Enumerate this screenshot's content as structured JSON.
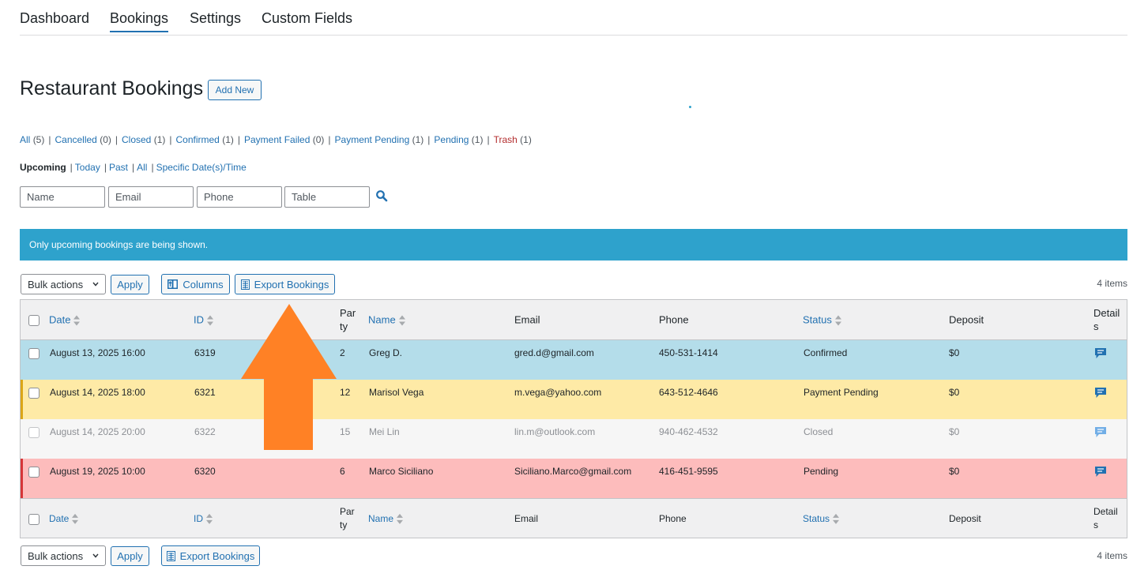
{
  "nav": {
    "tabs": [
      {
        "label": "Dashboard"
      },
      {
        "label": "Bookings"
      },
      {
        "label": "Settings"
      },
      {
        "label": "Custom Fields"
      }
    ]
  },
  "page": {
    "title": "Restaurant Bookings",
    "add_new": "Add New"
  },
  "status_filters": [
    {
      "label": "All",
      "count": "(5)"
    },
    {
      "label": "Cancelled",
      "count": "(0)"
    },
    {
      "label": "Closed",
      "count": "(1)"
    },
    {
      "label": "Confirmed",
      "count": "(1)"
    },
    {
      "label": "Payment Failed",
      "count": "(0)"
    },
    {
      "label": "Payment Pending",
      "count": "(1)"
    },
    {
      "label": "Pending",
      "count": "(1)"
    },
    {
      "label": "Trash",
      "count": "(1)"
    }
  ],
  "time_filters": {
    "current": "Upcoming",
    "items": [
      "Today",
      "Past",
      "All",
      "Specific Date(s)/Time"
    ]
  },
  "search": {
    "name_placeholder": "Name",
    "email_placeholder": "Email",
    "phone_placeholder": "Phone",
    "table_placeholder": "Table"
  },
  "notice": "Only upcoming bookings are being shown.",
  "toolbar": {
    "bulk_actions": "Bulk actions",
    "apply": "Apply",
    "columns": "Columns",
    "export": "Export Bookings",
    "items_count": "4 items"
  },
  "table": {
    "headers": {
      "date": "Date",
      "id": "ID",
      "party_1": "Par",
      "party_2": "ty",
      "name": "Name",
      "email": "Email",
      "phone": "Phone",
      "status": "Status",
      "deposit": "Deposit",
      "details_1": "Detail",
      "details_2": "s"
    },
    "rows": [
      {
        "date": "August 13, 2025 16:00",
        "id": "6319",
        "party": "2",
        "name": "Greg D.",
        "email": "gred.d@gmail.com",
        "phone": "450-531-1414",
        "status": "Confirmed",
        "deposit": "$0"
      },
      {
        "date": "August 14, 2025 18:00",
        "id": "6321",
        "party": "12",
        "name": "Marisol Vega",
        "email": "m.vega@yahoo.com",
        "phone": "643-512-4646",
        "status": "Payment Pending",
        "deposit": "$0"
      },
      {
        "date": "August 14, 2025 20:00",
        "id": "6322",
        "party": "15",
        "name": "Mei Lin",
        "email": "lin.m@outlook.com",
        "phone": "940-462-4532",
        "status": "Closed",
        "deposit": "$0"
      },
      {
        "date": "August 19, 2025 10:00",
        "id": "6320",
        "party": "6",
        "name": "Marco Siciliano",
        "email": "Siciliano.Marco@gmail.com",
        "phone": "416-451-9595",
        "status": "Pending",
        "deposit": "$0"
      }
    ]
  },
  "colors": {
    "accent": "#2271b1",
    "notice": "#2ea2cc",
    "confirmed_row": "#b4ddea",
    "payment_pending_row": "#feeaa6",
    "closed_row": "#f6f6f6",
    "pending_row": "#fdbcbc",
    "pending_bar": "#d63638",
    "payment_pending_bar": "#dba617",
    "arrow": "#ff8125"
  }
}
